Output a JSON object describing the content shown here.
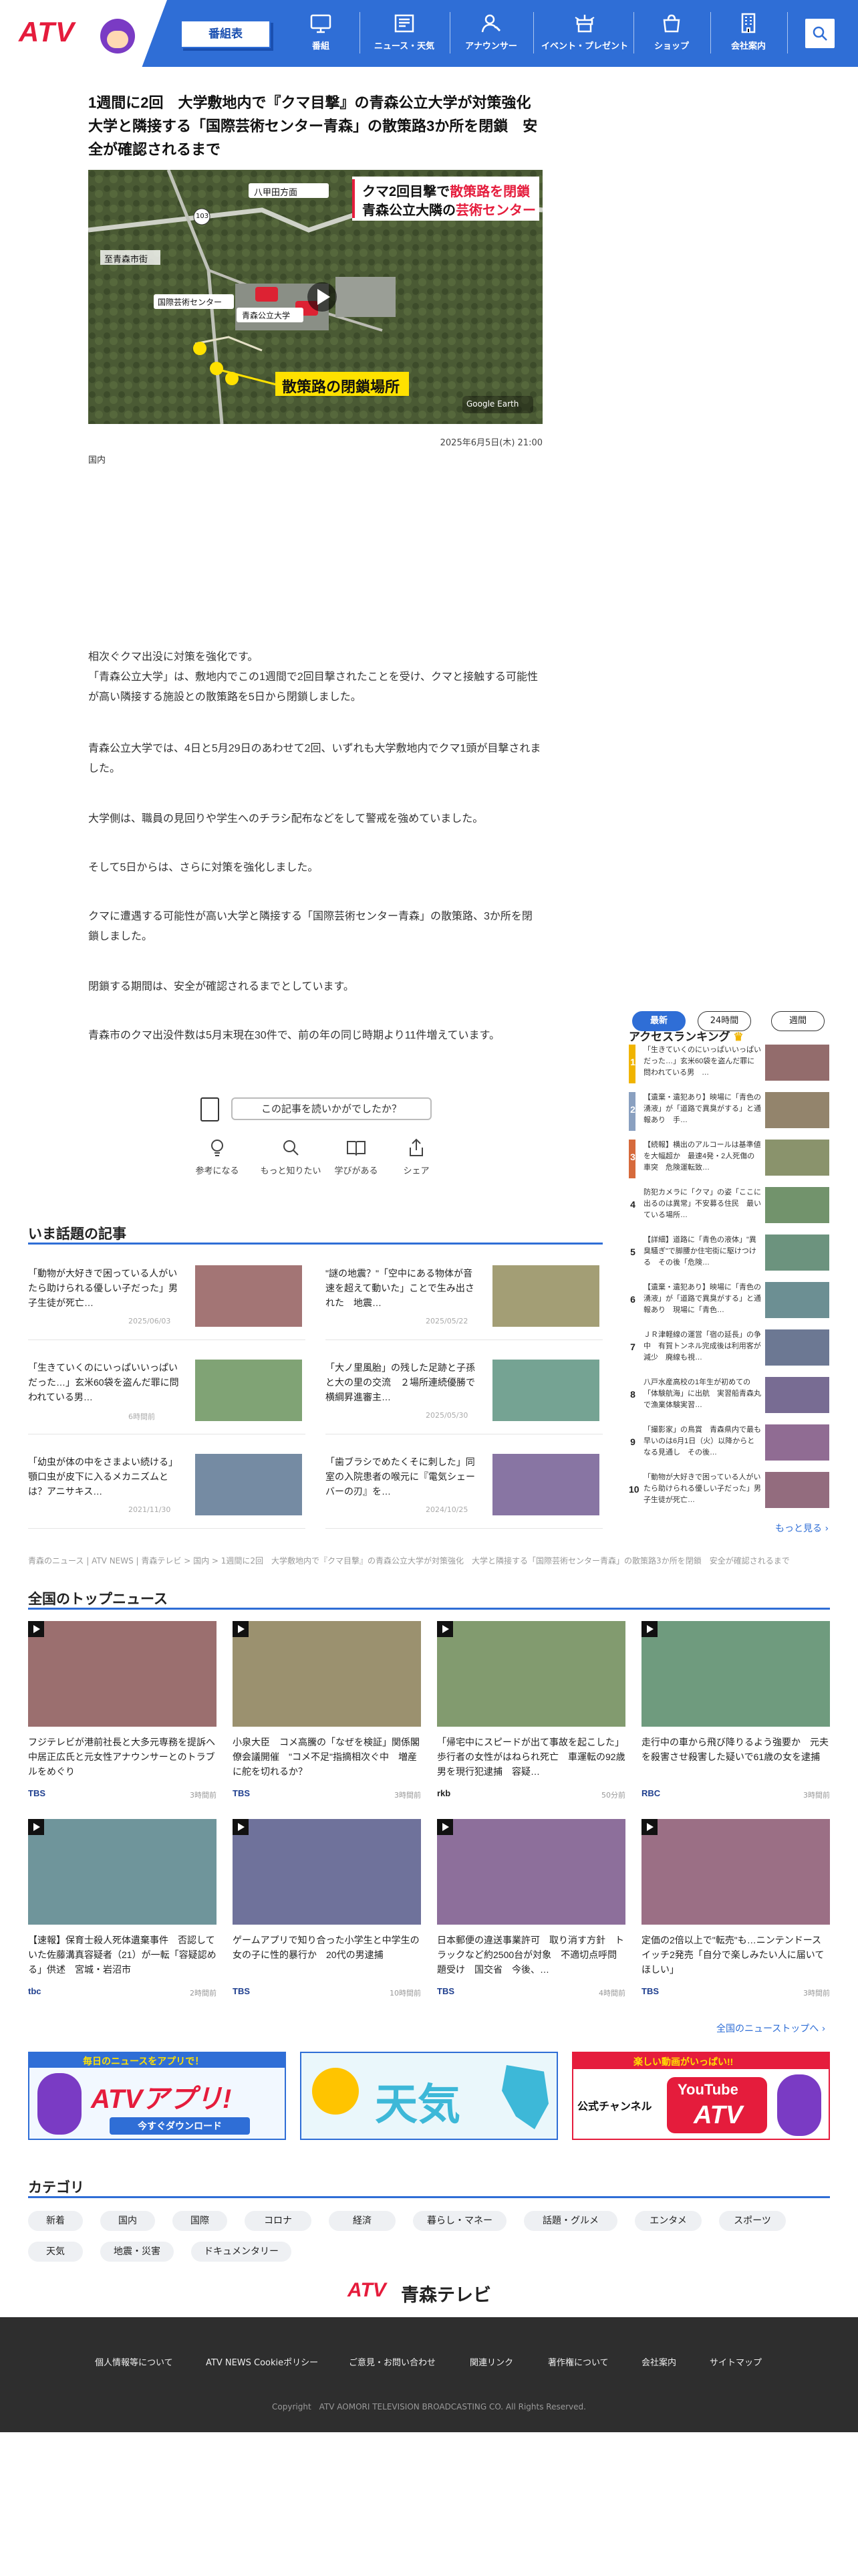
{
  "header": {
    "logo_text": "ATV",
    "program_button": "番組表",
    "nav": [
      {
        "label": "番組",
        "icon": "tv-icon"
      },
      {
        "label": "ニュース・天気",
        "icon": "newspaper-icon"
      },
      {
        "label": "アナウンサー",
        "icon": "announcer-icon"
      },
      {
        "label": "イベント・プレゼント",
        "icon": "event-icon"
      },
      {
        "label": "ショップ",
        "icon": "shop-icon"
      },
      {
        "label": "会社案内",
        "icon": "building-icon"
      }
    ]
  },
  "article": {
    "title": "1週間に2回　大学敷地内で『クマ目撃』の青森公立大学が対策強化　大学と隣接する「国際芸術センター青森」の散策路3か所を閉鎖　安全が確認されるまで",
    "hero": {
      "caption_line1_a": "クマ2回目撃で",
      "caption_line1_b": "散策路を閉鎖",
      "caption_line2_a": "青森公立大隣の",
      "caption_line2_b": "芸術センター",
      "label_hakkoda": "八甲田方面",
      "label_city": "至青森市街",
      "label_center": "国際芸術センター",
      "label_univ": "青森公立大学",
      "label_closed": "散策路の閉鎖場所",
      "road_number": "103",
      "watermark": "Google Earth"
    },
    "date": "2025年6月5日(木) 21:00",
    "category": "国内",
    "paragraphs": [
      "相次ぐクマ出没に対策を強化です。\n「青森公立大学」は、敷地内でこの1週間で2回目撃されたことを受け、クマと接触する可能性が高い隣接する施設との散策路を5日から閉鎖しました。",
      "青森公立大学では、4日と5月29日のあわせて2回、いずれも大学敷地内でクマ1頭が目撃されました。",
      "大学側は、職員の見回りや学生へのチラシ配布などをして警戒を強めていました。",
      "そして5日からは、さらに対策を強化しました。",
      "クマに遭遇する可能性が高い大学と隣接する「国際芸術センター青森」の散策路、3か所を閉鎖しました。",
      "閉鎖する期間は、安全が確認されるまでとしています。",
      "青森市のクマ出没件数は5月末現在30件で、前の年の同じ時期より11件増えています。"
    ],
    "feedback_question": "この記事を読いかがでしたか？",
    "feedback_options": [
      "参考になる",
      "もっと知りたい",
      "学びがある",
      "シェア"
    ]
  },
  "trending": {
    "title": "いま話題の記事",
    "items": [
      {
        "text": "「動物が大好きで困っている人がいたら助けられる優しい子だった」男子生徒が死亡…",
        "date": "2025/06/03"
      },
      {
        "text": "\"謎の地震？\"「空中にある物体が音速を超えて動いた」ことで生み出された　地震…",
        "date": "2025/05/22"
      },
      {
        "text": "「生きていくのにいっぱいいっぱいだった…」玄米60袋を盗んだ罪に問われている男…",
        "date": "6時間前"
      },
      {
        "text": "「大ノ里風胎」の残した足跡と子孫と大の里の交流　２場所連続優勝で横綱昇進審主…",
        "date": "2025/05/30"
      },
      {
        "text": "「幼虫が体の中をさまよい続ける」顎口虫が皮下に入るメカニズムとは？アニサキス…",
        "date": "2021/11/30"
      },
      {
        "text": "「歯ブラシでめたくそに刺した」同室の入院患者の喉元に『電気シェーバーの刃』を…",
        "date": "2024/10/25"
      }
    ]
  },
  "ranking": {
    "title": "アクセスランキング",
    "tabs": [
      "最新",
      "24時間",
      "週間"
    ],
    "items": [
      {
        "num": "1",
        "text": "「生きていくのにいっぱいいっぱいだった…」玄米60袋を盗んだ罪に問われている男　…"
      },
      {
        "num": "2",
        "text": "【遺棄・遺犯あり】映場に「青色の湧液」が「道路で異臭がする」と通報あり　手…"
      },
      {
        "num": "3",
        "text": "【続報】横出のアルコールは基準値を大幅超か　最速4発・2人死傷の車突　危険運転致…"
      },
      {
        "num": "4",
        "text": "防犯カメラに「クマ」の姿「ここに出るのは異常」不安募る住民　最いている場所…"
      },
      {
        "num": "5",
        "text": "【詳細】道路に「青色の液体」\"異臭騒ぎ\"で脚腰か住宅街に駆けつける　その後「危険…"
      },
      {
        "num": "6",
        "text": "【遺棄・遺犯あり】映場に「青色の湧液」が「道路で異臭がする」と通報あり　現場に「青色…"
      },
      {
        "num": "7",
        "text": "ＪＲ津軽線の運営「宿の延長」の争中　有賀トンネル完成後は利用客が減少　廃線も視…"
      },
      {
        "num": "8",
        "text": "八戸水産高校の1年生が初めての「体験航海」に出航　実習船青森丸で漁業体験実習…"
      },
      {
        "num": "9",
        "text": "「撮影家」の鳥賞　青森県内で最も早いのは6月1日（火）以降からとなる見通し　その後…"
      },
      {
        "num": "10",
        "text": "「動物が大好きで困っている人がいたら助けられる優しい子だった」男子生徒が死亡…"
      }
    ],
    "more": "もっと見る"
  },
  "breadcrumb": "青森のニュース | ATV NEWS | 青森テレビ > 国内 > 1週間に2回　大学敷地内で『クマ目撃』の青森公立大学が対策強化　大学と隣接する「国際芸術センター青森」の散策路3か所を閉鎖　安全が確認されるまで",
  "top_news": {
    "title": "全国のトップニュース",
    "items": [
      {
        "text": "フジテレビが港前社長と大多元専務を提訴へ　中居正広氏と元女性アナウンサーとのトラブルをめぐり",
        "source": "TBS",
        "time": "3時間前"
      },
      {
        "text": "小泉大臣　コメ高騰の「なぜを検証」関係閣僚会議開催　\"コメ不足\"指摘相次ぐ中　増産に舵を切れるか？",
        "source": "TBS",
        "time": "3時間前"
      },
      {
        "text": "「帰宅中にスピードが出て事故を起こした」歩行者の女性がはねられ死亡　車運転の92歳男を現行犯逮捕　容疑…",
        "source": "rkb",
        "time": "50分前"
      },
      {
        "text": "走行中の車から飛び降りるよう強要か　元夫を殺害させ殺害した疑いで61歳の女を逮捕",
        "source": "RBC",
        "time": "3時間前"
      },
      {
        "text": "【速報】保育士殺人死体遺棄事件　否認していた佐藤溝真容疑者（21）が一転「容疑認める」供述　宮城・岩沼市",
        "source": "tbc",
        "time": "2時間前"
      },
      {
        "text": "ゲームアプリで知り合った小学生と中学生の女の子に性的暴行か　20代の男逮捕",
        "source": "TBS",
        "time": "10時間前"
      },
      {
        "text": "日本郵便の違送事業許可　取り消す方針　トラックなど約2500台が対象　不適切点呼問題受け　国交省　今後、…",
        "source": "TBS",
        "time": "4時間前"
      },
      {
        "text": "定価の2倍以上で\"転売\"も…ニンテンドースイッチ2発売「自分で楽しみたい人に届いてほしい」",
        "source": "TBS",
        "time": "3時間前"
      }
    ],
    "more": "全国のニューストップへ"
  },
  "banners": {
    "app_top": "毎日のニュースをアプリで！",
    "app_main": "ATVアプリ!",
    "app_bottom": "今すぐダウンロード",
    "weather": "天気",
    "youtube_top": "楽しい動画がいっぱい!!",
    "youtube_left": "公式チャンネル",
    "youtube_logo": "YouTube",
    "youtube_atv": "ATV"
  },
  "categories": {
    "title": "カテゴリ",
    "items": [
      "新着",
      "国内",
      "国際",
      "コロナ",
      "経済",
      "暮らし・マネー",
      "話題・グルメ",
      "エンタメ",
      "スポーツ",
      "天気",
      "地震・災害",
      "ドキュメンタリー"
    ]
  },
  "footer": {
    "logo_atv": "ATV",
    "logo_name": "青森テレビ",
    "links": [
      "個人情報等について",
      "ATV NEWS Cookieポリシー",
      "ご意見・お問い合わせ",
      "関連リンク",
      "著作権について",
      "会社案内",
      "サイトマップ"
    ],
    "copyright": "Copyright　ATV AOMORI TELEVISION BROADCASTING CO. All Rights Reserved."
  },
  "colors": {
    "brand_blue": "#2f6ed6",
    "brand_red": "#e51c3c",
    "footer_bg": "#2e2e2e"
  }
}
